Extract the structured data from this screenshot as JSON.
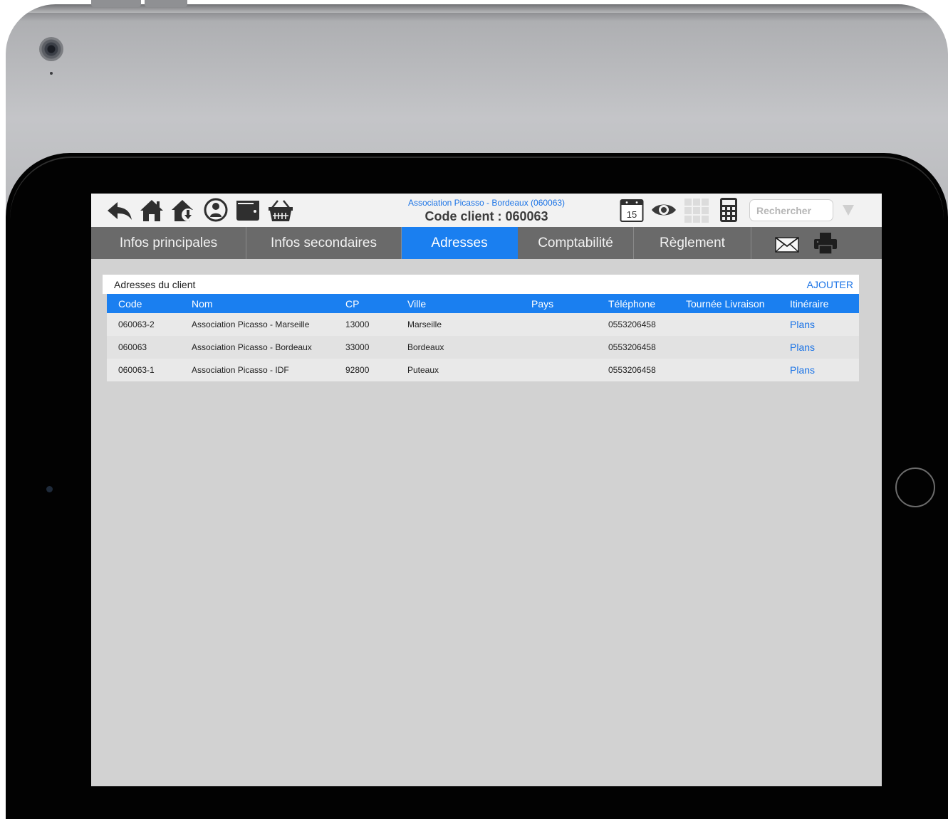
{
  "header": {
    "client_name": "Association Picasso - Bordeaux (060063)",
    "client_code": "Code client : 060063",
    "calendar_day": "15",
    "search_placeholder": "Rechercher"
  },
  "toolbar_icons": [
    "back-arrow-icon",
    "home-icon",
    "home-download-icon",
    "user-icon",
    "wallet-icon",
    "basket-icon",
    "calendar-icon",
    "eye-icon",
    "grid-icon",
    "calculator-icon",
    "dropdown-arrow-icon"
  ],
  "tabs": [
    {
      "label": "Infos principales",
      "active": false
    },
    {
      "label": "Infos secondaires",
      "active": false
    },
    {
      "label": "Adresses",
      "active": true
    },
    {
      "label": "Comptabilité",
      "active": false
    },
    {
      "label": "Règlement",
      "active": false
    }
  ],
  "tab_icons": [
    "mail-icon",
    "printer-icon"
  ],
  "panel": {
    "title": "Adresses du client",
    "add_label": "AJOUTER"
  },
  "table": {
    "columns": [
      "Code",
      "Nom",
      "CP",
      "Ville",
      "Pays",
      "Téléphone",
      "Tournée Livraison",
      "Itinéraire"
    ],
    "rows": [
      {
        "code": "060063-2",
        "nom": "Association Picasso - Marseille",
        "cp": "13000",
        "ville": "Marseille",
        "pays": "",
        "telephone": "0553206458",
        "tournee": "",
        "itineraire": "Plans"
      },
      {
        "code": "060063",
        "nom": "Association Picasso - Bordeaux",
        "cp": "33000",
        "ville": "Bordeaux",
        "pays": "",
        "telephone": "0553206458",
        "tournee": "",
        "itineraire": "Plans"
      },
      {
        "code": "060063-1",
        "nom": "Association Picasso - IDF",
        "cp": "92800",
        "ville": "Puteaux",
        "pays": "",
        "telephone": "0553206458",
        "tournee": "",
        "itineraire": "Plans"
      }
    ]
  },
  "colors": {
    "accent": "#1a7ff0",
    "link": "#1a73e6",
    "tabbar": "#6a6a6a",
    "screen_bg": "#d2d2d2"
  }
}
